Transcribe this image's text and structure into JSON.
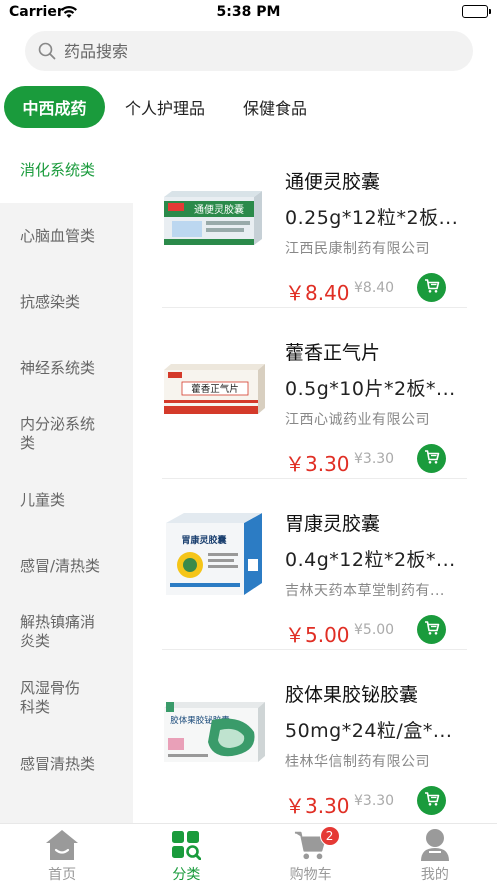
{
  "status_bar": {
    "carrier": "Carrier",
    "time": "5:38 PM"
  },
  "search": {
    "placeholder": "药品搜索"
  },
  "top_categories": [
    {
      "label": "中西成药",
      "active": true
    },
    {
      "label": "个人护理品",
      "active": false
    },
    {
      "label": "保健食品",
      "active": false
    }
  ],
  "sidebar": {
    "items": [
      {
        "label": "消化系统类",
        "active": true
      },
      {
        "label": "心脑血管类"
      },
      {
        "label": "抗感染类"
      },
      {
        "label": "神经系统类"
      },
      {
        "label": "内分泌系统类"
      },
      {
        "label": "儿童类"
      },
      {
        "label": "感冒/清热类"
      },
      {
        "label": "解热镇痛消炎类"
      },
      {
        "label": "风湿骨伤科类"
      },
      {
        "label": "感冒清热类"
      }
    ]
  },
  "products": [
    {
      "name": "通便灵胶囊",
      "spec": "0.25g*12粒*2板...",
      "maker": "江西民康制药有限公司",
      "price": "￥8.40",
      "original_price": "¥8.40",
      "box_title": "通便灵胶囊",
      "box_color": "#2b8a4a"
    },
    {
      "name": "藿香正气片",
      "spec": "0.5g*10片*2板*...",
      "maker": "江西心诚药业有限公司",
      "price": "￥3.30",
      "original_price": "¥3.30",
      "box_title": "藿香正气片",
      "box_color": "#d43a2a"
    },
    {
      "name": "胃康灵胶囊",
      "spec": "0.4g*12粒*2板*...",
      "maker": "吉林天药本草堂制药有...",
      "price": "￥5.00",
      "original_price": "¥5.00",
      "box_title": "胃康灵胶囊",
      "box_color": "#2c7cc4"
    },
    {
      "name": "胶体果胶铋胶囊",
      "spec": "50mg*24粒/盒*...",
      "maker": "桂林华信制药有限公司",
      "price": "￥3.30",
      "original_price": "¥3.30",
      "box_title": "胶体果胶铋胶囊",
      "box_color": "#3a9b6a"
    }
  ],
  "tabbar": {
    "items": [
      {
        "label": "首页",
        "icon": "home-icon"
      },
      {
        "label": "分类",
        "icon": "category-icon",
        "active": true
      },
      {
        "label": "购物车",
        "icon": "cart-icon",
        "badge": "2"
      },
      {
        "label": "我的",
        "icon": "user-icon"
      }
    ]
  },
  "colors": {
    "accent": "#1a9b3c",
    "price": "#e02e24"
  }
}
